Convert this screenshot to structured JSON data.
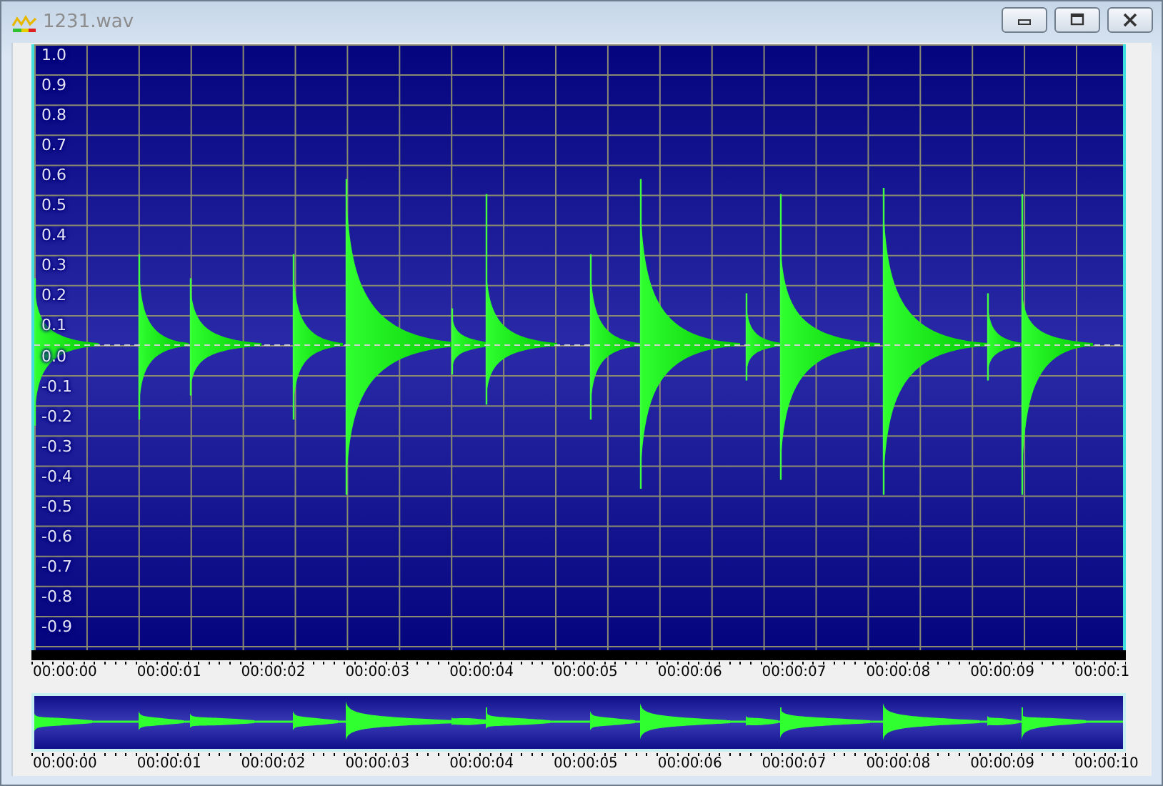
{
  "window": {
    "title": "1231.wav"
  },
  "waveform": {
    "amplitude_labels": [
      "1.0",
      "0.9",
      "0.8",
      "0.7",
      "0.6",
      "0.5",
      "0.4",
      "0.3",
      "0.2",
      "0.1",
      "0.0",
      "-0.1",
      "-0.2",
      "-0.3",
      "-0.4",
      "-0.5",
      "-0.6",
      "-0.7",
      "-0.8",
      "-0.9"
    ],
    "time_labels": [
      "00:00:00",
      "00:00:01",
      "00:00:02",
      "00:00:03",
      "00:00:04",
      "00:00:05",
      "00:00:06",
      "00:00:07",
      "00:00:08",
      "00:00:09",
      "00:00:1"
    ]
  },
  "overview": {
    "time_labels": [
      "00:00:00",
      "00:00:01",
      "00:00:02",
      "00:00:03",
      "00:00:04",
      "00:00:05",
      "00:00:06",
      "00:00:07",
      "00:00:08",
      "00:00:09",
      "00:00:10"
    ]
  }
}
